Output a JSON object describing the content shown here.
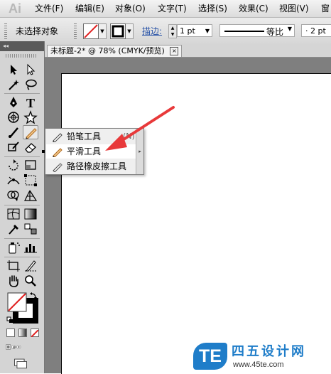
{
  "app": {
    "logo": "Ai"
  },
  "menubar": {
    "items": [
      "文件(F)",
      "编辑(E)",
      "对象(O)",
      "文字(T)",
      "选择(S)",
      "效果(C)",
      "视图(V)",
      "窗"
    ]
  },
  "controlbar": {
    "selection_status": "未选择对象",
    "stroke_label": "描边:",
    "stroke_weight": "1 pt",
    "stroke_style_label": "等比",
    "profile_value": "· 2 pt"
  },
  "document": {
    "tab_title": "未标题-2* @ 78% (CMYK/预览)",
    "tab_close": "×"
  },
  "tools_panel": {
    "collapse_glyph": "◂◂"
  },
  "flyout": {
    "items": [
      {
        "label": "铅笔工具",
        "shortcut": "(N)",
        "icon": "pencil-icon",
        "selected": false
      },
      {
        "label": "平滑工具",
        "shortcut": "",
        "icon": "smooth-icon",
        "selected": true
      },
      {
        "label": "路径橡皮擦工具",
        "shortcut": "",
        "icon": "path-eraser-icon",
        "selected": false
      }
    ],
    "tearoff_glyph": "▸"
  },
  "annotation": {
    "arrow_color": "#e8393a"
  },
  "watermark": {
    "logo_text": "TE",
    "name": "四五设计网",
    "url": "www.45te.com",
    "brand_color": "#1f7dc9"
  }
}
